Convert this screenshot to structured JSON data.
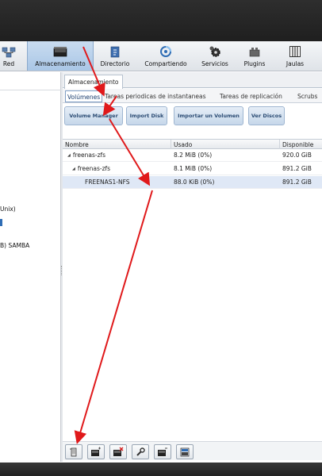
{
  "toolbar": {
    "items": [
      {
        "label": "Red",
        "icon": "network-icon"
      },
      {
        "label": "Almacenamiento",
        "icon": "storage-icon",
        "active": true
      },
      {
        "label": "Directorio",
        "icon": "directory-icon"
      },
      {
        "label": "Compartiendo",
        "icon": "sharing-icon"
      },
      {
        "label": "Servicios",
        "icon": "services-gear-icon"
      },
      {
        "label": "Plugins",
        "icon": "plugins-icon"
      },
      {
        "label": "Jaulas",
        "icon": "jails-icon"
      }
    ]
  },
  "left_pane": {
    "lines": [
      "Unix)",
      "B) SAMBA"
    ]
  },
  "outer_tab": {
    "label": "Almacenamiento"
  },
  "inner_tabs": [
    {
      "label": "Volúmenes",
      "active": true
    },
    {
      "label": "Tareas periodicas de instantaneas"
    },
    {
      "label": "Tareas de replicación"
    },
    {
      "label": "Scrubs"
    }
  ],
  "buttons": {
    "volume_manager": "Volume Manager",
    "import_disk": "Import Disk",
    "import_volume": "Importar un Volumen",
    "view_disks": "Ver Discos"
  },
  "grid": {
    "columns": [
      "Nombre",
      "Usado",
      "Disponible"
    ],
    "rows": [
      {
        "name": "freenas-zfs",
        "used": "8.2 MiB (0%)",
        "available": "920.0 GiB",
        "level": 0,
        "expanded": true
      },
      {
        "name": "freenas-zfs",
        "used": "8.1 MiB (0%)",
        "available": "891.2 GiB",
        "level": 1,
        "expanded": true
      },
      {
        "name": "FREENAS1-NFS",
        "used": "88.0 KiB (0%)",
        "available": "891.2 GiB",
        "level": 2,
        "selected": true
      }
    ]
  },
  "bottom_tools": [
    {
      "icon": "detach-volume-icon"
    },
    {
      "icon": "scrub-volume-icon"
    },
    {
      "icon": "delete-dataset-icon"
    },
    {
      "icon": "edit-options-icon"
    },
    {
      "icon": "create-dataset-icon"
    },
    {
      "icon": "create-zvol-icon"
    }
  ],
  "colors": {
    "annotation_arrow": "#e0191b",
    "active_toolbar": "#b5cfea",
    "selected_row": "#dfe8f6"
  }
}
